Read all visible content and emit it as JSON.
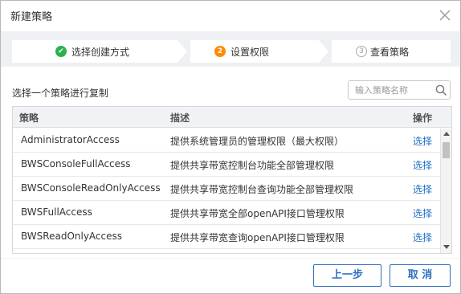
{
  "dialog": {
    "title": "新建策略",
    "close_icon": "close-icon"
  },
  "steps": [
    {
      "label": "选择创建方式",
      "status": "done",
      "icon": "✔",
      "icon_color": "#2bb24c"
    },
    {
      "label": "设置权限",
      "status": "current",
      "icon": "2",
      "icon_color": "#ff8a00"
    },
    {
      "label": "查看策略",
      "status": "pending",
      "icon": "3",
      "icon_color": "#aaaaaa"
    }
  ],
  "copy_section": {
    "label": "选择一个策略进行复制",
    "search_placeholder": "输入策略名称",
    "search_icon": "search-icon"
  },
  "table": {
    "headers": {
      "policy": "策略",
      "description": "描述",
      "operation": "操作"
    },
    "rows": [
      {
        "policy": "AdministratorAccess",
        "description": "提供系统管理员的管理权限（最大权限）",
        "action": "选择"
      },
      {
        "policy": "BWSConsoleFullAccess",
        "description": "提供共享带宽控制台功能全部管理权限",
        "action": "选择"
      },
      {
        "policy": "BWSConsoleReadOnlyAccess",
        "description": "提供共享带宽控制台查询功能全部管理权限",
        "action": "选择"
      },
      {
        "policy": "BWSFullAccess",
        "description": "提供共享带宽全部openAPI接口管理权限",
        "action": "选择"
      },
      {
        "policy": "BWSReadOnlyAccess",
        "description": "提供共享带宽查询openAPI接口管理权限",
        "action": "选择"
      }
    ]
  },
  "footer": {
    "prev_label": "上一步",
    "cancel_label": "取 消"
  },
  "colors": {
    "accent": "#2f6fbf",
    "link": "#1f6fc5",
    "done": "#2bb24c",
    "current": "#ff8a00"
  }
}
